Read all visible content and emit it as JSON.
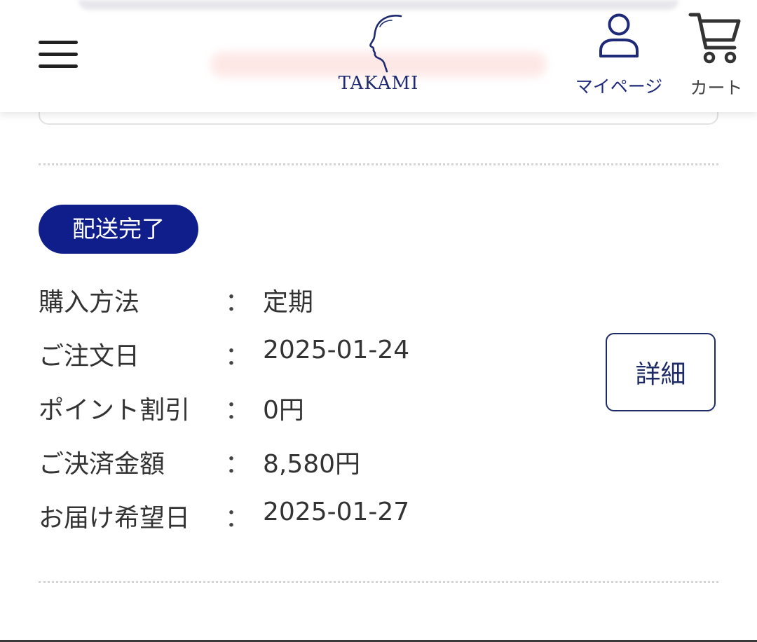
{
  "header": {
    "logo_text": "TAKAMI",
    "mypage_label": "マイページ",
    "cart_label": "カート"
  },
  "order": {
    "status_badge": "配送完了",
    "separator": "：",
    "rows": [
      {
        "label": "購入方法",
        "value": "定期"
      },
      {
        "label": "ご注文日",
        "value": "2025-01-24"
      },
      {
        "label": "ポイント割引",
        "value": "0円"
      },
      {
        "label": "ご決済金額",
        "value": "8,580円"
      },
      {
        "label": "お届け希望日",
        "value": "2025-01-27"
      }
    ],
    "detail_button_label": "詳細"
  },
  "icons": {
    "menu": "hamburger-menu-icon",
    "logo": "takami-face-logo",
    "user": "user-icon",
    "cart": "cart-icon"
  },
  "colors": {
    "brand_navy": "#0f1e8a",
    "text_navy": "#1e2a78",
    "text": "#333333"
  }
}
